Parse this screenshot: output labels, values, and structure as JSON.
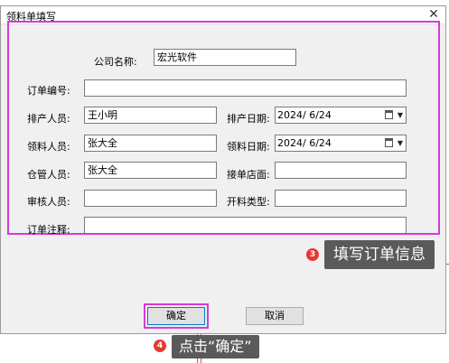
{
  "dialog": {
    "title": "领料单填写",
    "close_glyph": "✕"
  },
  "form": {
    "company": {
      "label": "公司名称:",
      "value": "宏光软件"
    },
    "order_no": {
      "label": "订单编号:",
      "value": ""
    },
    "producer": {
      "label": "排产人员:",
      "value": "王小明"
    },
    "production_date": {
      "label": "排产日期:",
      "value": "2024/ 6/24"
    },
    "picker": {
      "label": "领料人员:",
      "value": "张大全"
    },
    "pick_date": {
      "label": "领料日期:",
      "value": "2024/ 6/24"
    },
    "warehouse_keeper": {
      "label": "仓管人员:",
      "value": "张大全"
    },
    "receiving_store": {
      "label": "接单店面:",
      "value": ""
    },
    "reviewer": {
      "label": "审核人员:",
      "value": ""
    },
    "invoice_type": {
      "label": "开料类型:",
      "value": ""
    },
    "order_note": {
      "label": "订单注释:",
      "value": ""
    }
  },
  "buttons": {
    "confirm": "确定",
    "cancel": "取消"
  },
  "callouts": [
    {
      "step": "3",
      "text": "填写订单信息"
    },
    {
      "step": "4",
      "text": "点击“确定”"
    }
  ],
  "colors": {
    "highlight": "#d63ad6",
    "callout_bg": "#5a5a5a",
    "badge": "#e53935",
    "dialog_bg": "#f0f0f0"
  },
  "icons": {
    "close": "close-icon",
    "calendar": "calendar-icon",
    "dropdown": "chevron-down-icon"
  }
}
